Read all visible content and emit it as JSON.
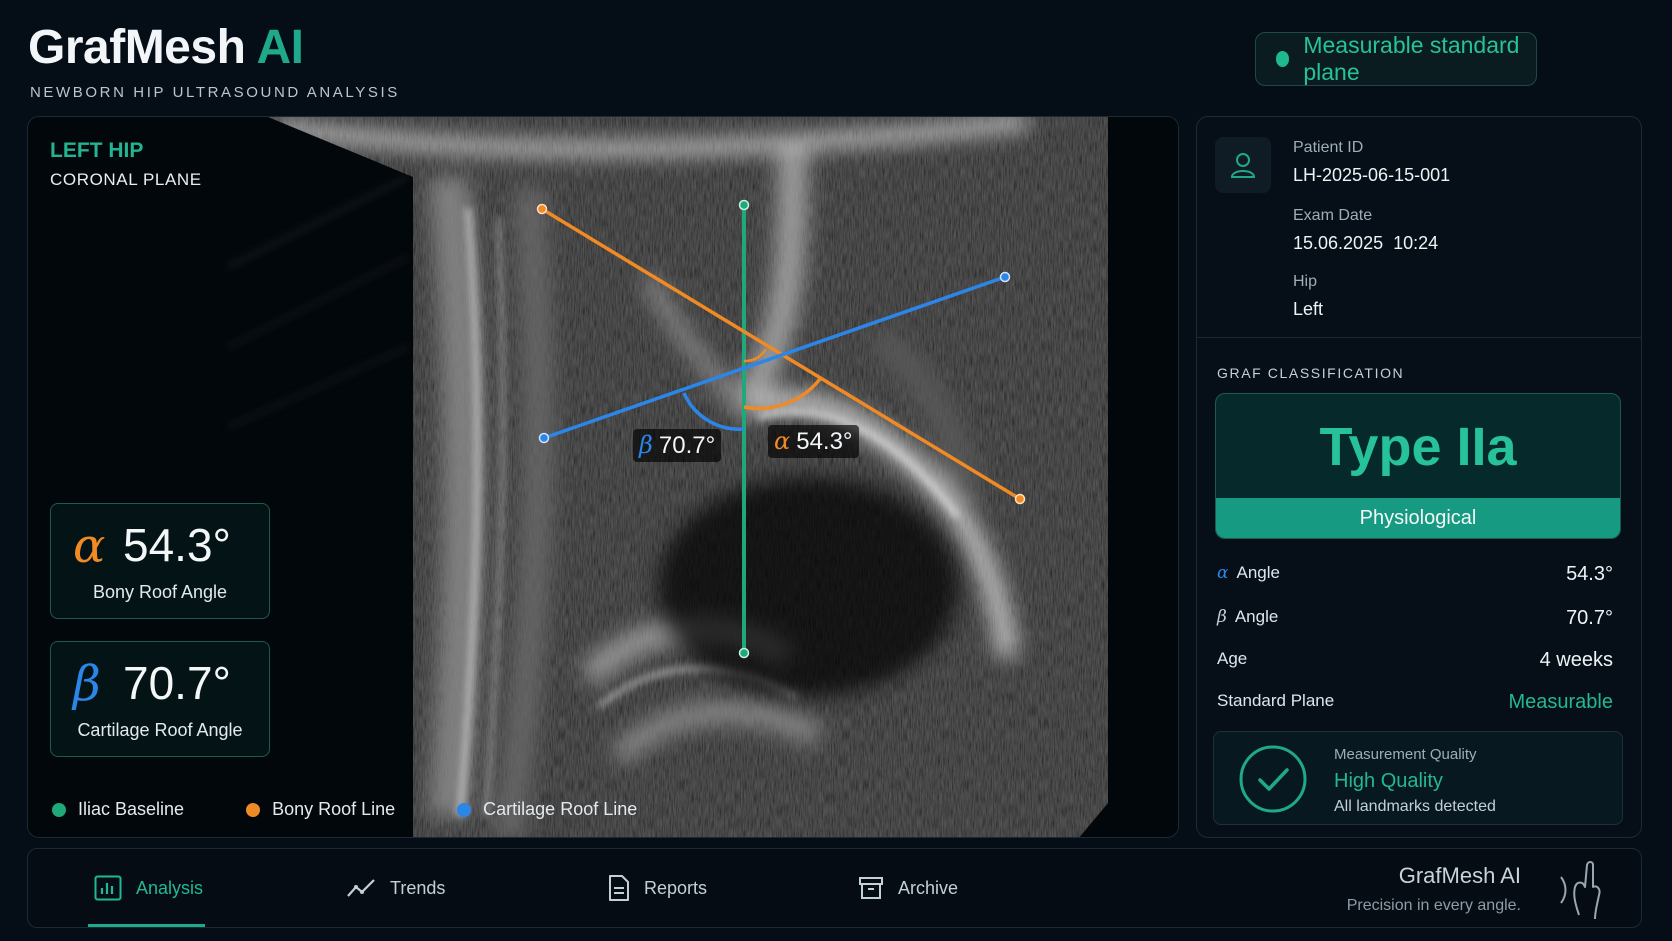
{
  "header": {
    "title_main": "GrafMesh",
    "title_accent": "AI",
    "subtitle": "NEWBORN HIP ULTRASOUND ANALYSIS",
    "plane_status": "Measurable standard plane"
  },
  "viewer": {
    "hip_side": "LEFT HIP",
    "plane": "CORONAL PLANE",
    "beta_label_symbol": "β",
    "beta_label_value": "70.7°",
    "alpha_label_symbol": "α",
    "alpha_label_value": "54.3°",
    "alpha_card": {
      "symbol": "α",
      "value": "54.3°",
      "name": "Bony Roof Angle"
    },
    "beta_card": {
      "symbol": "β",
      "value": "70.7°",
      "name": "Cartilage Roof Angle"
    },
    "legend": [
      {
        "label": "Iliac Baseline",
        "color": "#1fa879"
      },
      {
        "label": "Bony Roof Line",
        "color": "#f08a24"
      },
      {
        "label": "Cartilage Roof Line",
        "color": "#2b86e8"
      }
    ]
  },
  "patient": {
    "id_label": "Patient ID",
    "id_value": "LH-2025-06-15-001",
    "date_label": "Exam Date",
    "date_value": "15.06.2025  10:24",
    "hip_label": "Hip",
    "hip_value": "Left"
  },
  "classification": {
    "heading": "GRAF CLASSIFICATION",
    "type": "Type IIa",
    "category": "Physiological",
    "rows": [
      {
        "symbol": "α",
        "label": "Angle",
        "value": "54.3°"
      },
      {
        "symbol": "β",
        "label": "Angle",
        "value": "70.7°"
      },
      {
        "symbol": "",
        "label": "Age",
        "value": "4 weeks"
      },
      {
        "symbol": "",
        "label": "Standard Plane",
        "value": "Measurable"
      }
    ],
    "quality_label": "Measurement Quality",
    "quality_value": "High Quality",
    "quality_note": "All landmarks detected"
  },
  "nav": {
    "items": [
      {
        "label": "Analysis",
        "icon": "analysis-icon",
        "active": true
      },
      {
        "label": "Trends",
        "icon": "trends-icon",
        "active": false
      },
      {
        "label": "Reports",
        "icon": "document-icon",
        "active": false
      },
      {
        "label": "Archive",
        "icon": "archive-icon",
        "active": false
      }
    ],
    "brand_name": "GrafMesh AI",
    "tagline": "Precision in every angle."
  },
  "colors": {
    "accent": "#1fa98a",
    "bony_roof": "#f08a24",
    "cartilage_roof": "#2b86e8",
    "background": "#050d16"
  }
}
